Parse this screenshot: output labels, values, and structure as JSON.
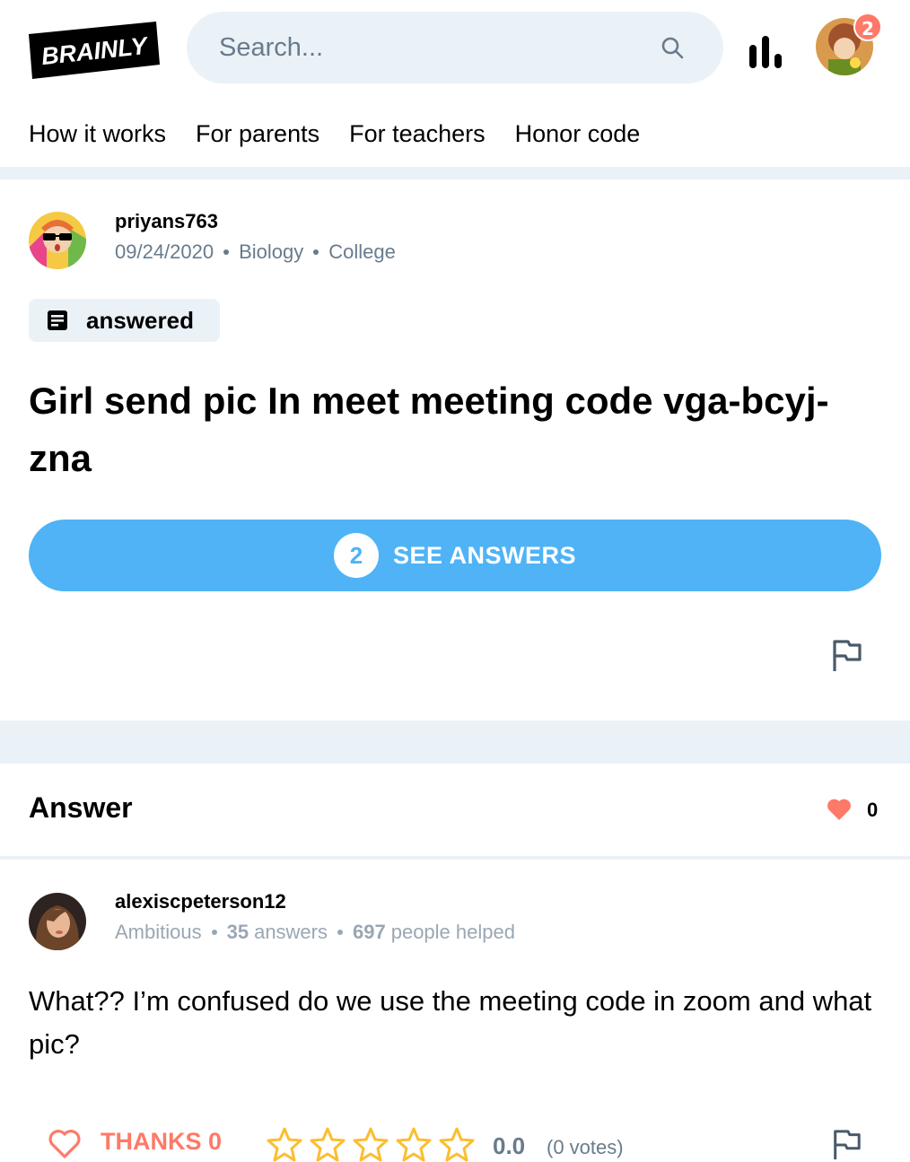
{
  "header": {
    "logo_text": "BRAINLY",
    "search_placeholder": "Search...",
    "notification_count": "2"
  },
  "nav": {
    "items": [
      {
        "label": "How it works"
      },
      {
        "label": "For parents"
      },
      {
        "label": "For teachers"
      },
      {
        "label": "Honor code"
      }
    ]
  },
  "question": {
    "author": "priyans763",
    "date": "09/24/2020",
    "subject": "Biology",
    "level": "College",
    "status": "answered",
    "title": "Girl send pic In meet meeting code vga-bcyj-zna",
    "answers_count": "2",
    "see_answers_label": "SEE ANSWERS"
  },
  "answer": {
    "heading": "Answer",
    "likes": "0",
    "author": "alexiscpeterson12",
    "rank": "Ambitious",
    "answers_num": "35",
    "answers_label": "answers",
    "helped_num": "697",
    "helped_label": "people helped",
    "text": "What?? I’m confused do we use the meeting code in zoom and what pic?",
    "thanks_label": "THANKS 0",
    "rating": "0.0",
    "votes": "(0 votes)"
  },
  "colors": {
    "brand_blue": "#4fb3f6",
    "accent_red": "#ff7968",
    "star_yellow": "#fbbe2e",
    "muted": "#687b8c",
    "light_bg": "#ebf2f7"
  }
}
